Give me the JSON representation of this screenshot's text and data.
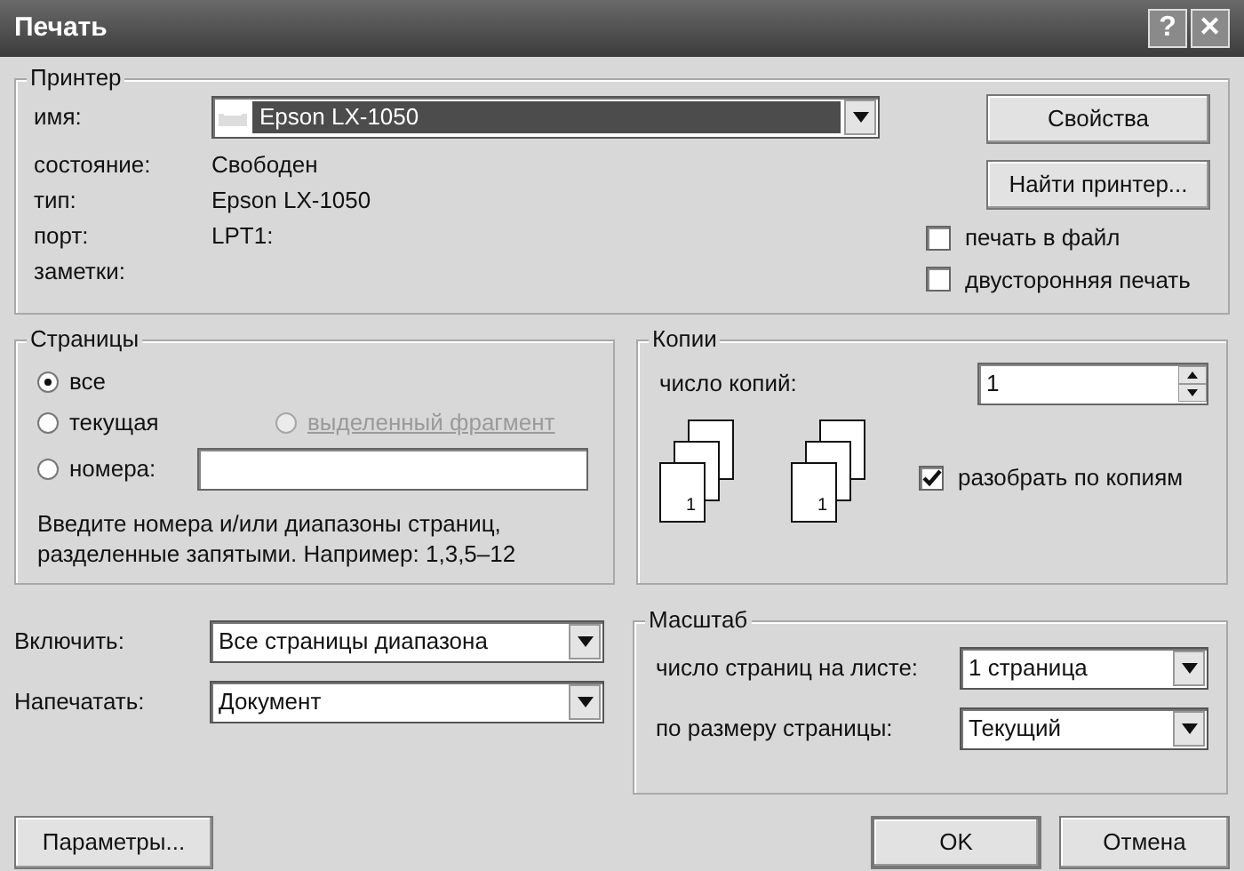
{
  "window": {
    "title": "Печать",
    "help_button": "?",
    "close_button": "✕"
  },
  "printer": {
    "group_title": "Принтер",
    "name": {
      "label": "имя:",
      "value": "Epson LX-1050",
      "focused": true
    },
    "info": [
      {
        "label": "состояние:",
        "value": "Свободен"
      },
      {
        "label": "тип:",
        "value": "Epson LX-1050"
      },
      {
        "label": "порт:",
        "value": "LPT1:"
      },
      {
        "label": "заметки:"
      }
    ],
    "buttons": [
      "Свойства",
      "Найти принтер..."
    ],
    "checkboxes": [
      {
        "label": "печать в файл",
        "checked": false
      },
      {
        "label": "двусторонняя печать",
        "checked": false
      }
    ]
  },
  "pages": {
    "group_title": "Страницы",
    "options": [
      {
        "label": "все",
        "selected": true,
        "disabled": false
      },
      {
        "label": "текущая",
        "selected": false,
        "disabled": false
      },
      {
        "label": "выделенный фрагмент",
        "selected": false,
        "disabled": true
      },
      {
        "label": "номера:",
        "selected": false,
        "disabled": false
      }
    ],
    "hint": "Введите номера и/или диапазоны страниц, разделенные запятыми. Например: 1,3,5–12"
  },
  "copies": {
    "group_title": "Копии",
    "count_label": "число копий:",
    "count": "1",
    "stacks": [
      {
        "front_page": "1"
      },
      {
        "front_page": "1"
      }
    ],
    "collate": {
      "label": "разобрать по копиям",
      "checked": true
    }
  },
  "options": [
    {
      "label": "Включить:",
      "value": "Все страницы диапазона"
    },
    {
      "label": "Напечатать:",
      "value": "Документ"
    }
  ],
  "scale": {
    "group_title": "Масштаб",
    "rows": [
      {
        "label": "число страниц на листе:",
        "value": "1 страница"
      },
      {
        "label": "по размеру страницы:",
        "value": "Текущий"
      }
    ]
  },
  "footer": {
    "params_button": "Параметры...",
    "ok_button": "OK",
    "cancel_button": "Отмена"
  }
}
